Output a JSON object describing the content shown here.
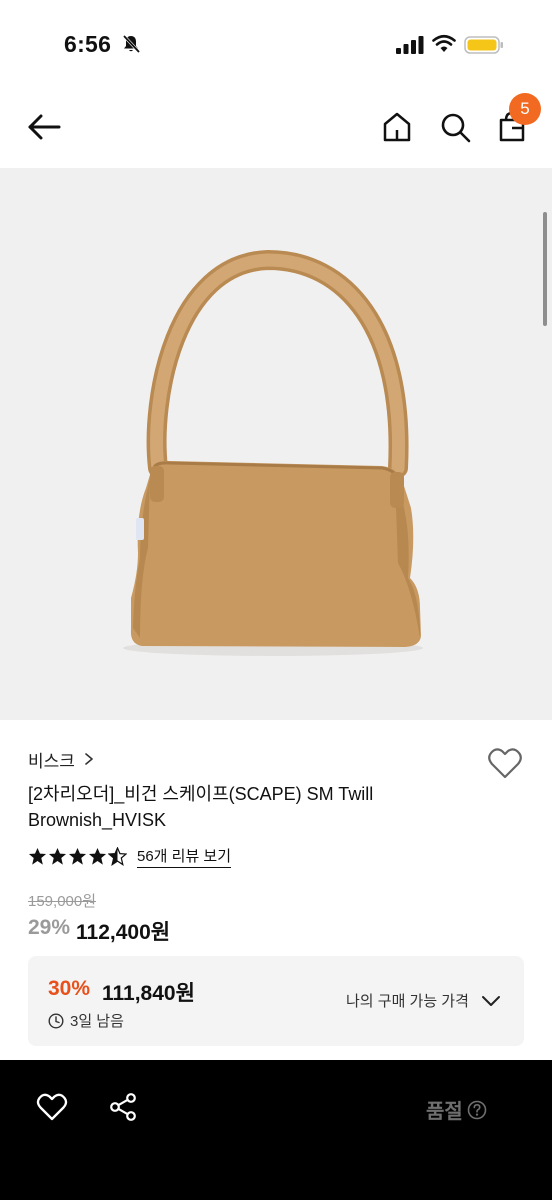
{
  "status_bar": {
    "time": "6:56"
  },
  "nav": {
    "cart_count": "5"
  },
  "product": {
    "brand": "비스크",
    "title": "[2차리오더]_비건 스케이프(SCAPE) SM Twill Brownish_HVISK",
    "rating": 4.5,
    "review_link": "56개 리뷰 보기",
    "original_price": "159,000원",
    "discount": "29%",
    "price": "112,400원"
  },
  "offer": {
    "discount": "30%",
    "price": "111,840원",
    "time_left": "3일 남음",
    "link_label": "나의 구매 가능 가격"
  },
  "bottom_bar": {
    "status_label": "품절"
  },
  "colors": {
    "accent": "#f26a21",
    "offer_red": "#e8501c",
    "bag": "#c89a62"
  }
}
